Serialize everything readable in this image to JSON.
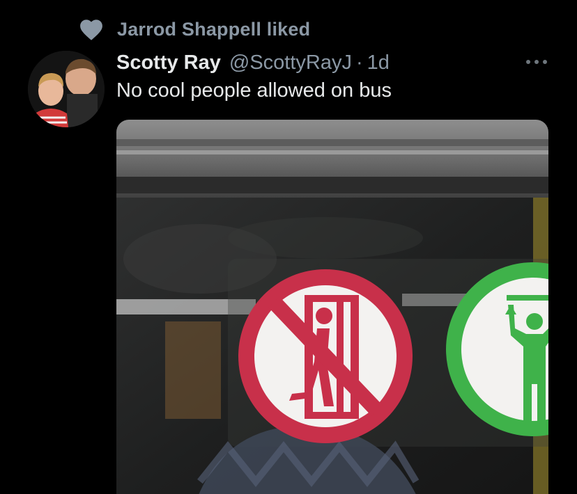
{
  "social_context": {
    "icon": "heart-icon",
    "text": "Jarrod Shappell liked"
  },
  "tweet": {
    "author": {
      "display_name": "Scotty Ray",
      "handle": "@ScottyRayJ",
      "avatar_icon": "avatar"
    },
    "separator": "·",
    "timestamp": "1d",
    "text": "No cool people allowed on bus",
    "more_icon": "more-horizontal-icon",
    "media": {
      "signs": [
        {
          "kind": "prohibition",
          "color": "#c8304a",
          "icon": "no-leaning-on-door-icon"
        },
        {
          "kind": "mandatory",
          "color": "#3fb24a",
          "icon": "hold-handrail-icon"
        }
      ]
    }
  },
  "colors": {
    "background": "#000000",
    "primary_text": "#e7e9ea",
    "secondary_text": "#8b98a5",
    "like_icon": "#8b98a5"
  }
}
